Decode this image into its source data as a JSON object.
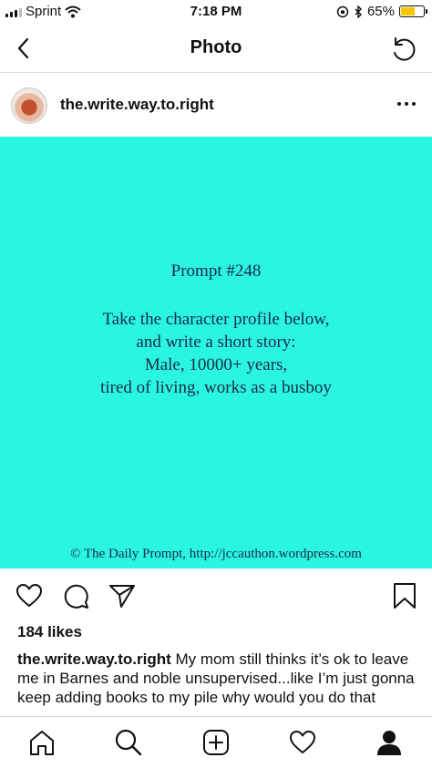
{
  "status_bar": {
    "carrier": "Sprint",
    "time": "7:18 PM",
    "battery_percent": "65%",
    "battery_level": 0.65
  },
  "header": {
    "title": "Photo"
  },
  "post": {
    "username": "the.write.way.to.right",
    "image": {
      "background_color": "#2af5e0",
      "prompt_number": "Prompt #248",
      "lines": [
        "Take the character profile below,",
        "and write a short story:",
        "Male, 10000+ years,",
        "tired of living, works as a busboy"
      ],
      "footer": "© The Daily Prompt, http://jccauthon.wordpress.com"
    },
    "likes": "184 likes",
    "caption": {
      "username": "the.write.way.to.right",
      "text": "My mom still thinks it’s ok to leave me in Barnes and noble unsupervised...like I’m just gonna keep adding books to my pile why would you do that"
    }
  },
  "icons": {
    "back": "back-chevron-icon",
    "refresh": "refresh-icon",
    "more": "more-horizontal-icon",
    "like": "heart-icon",
    "comment": "comment-icon",
    "share": "send-icon",
    "save": "bookmark-icon",
    "home": "home-icon",
    "search": "search-icon",
    "add": "add-post-icon",
    "activity": "heart-icon",
    "profile": "profile-icon"
  }
}
